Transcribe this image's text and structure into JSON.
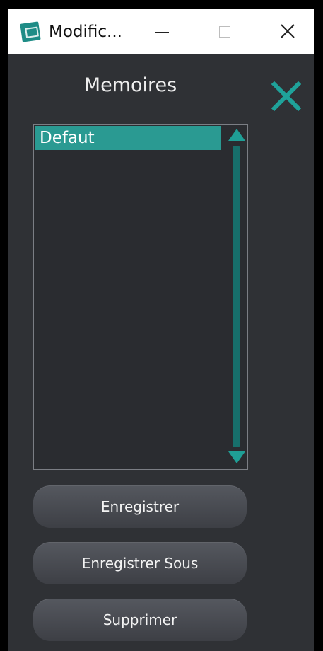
{
  "window": {
    "title": "Modific...",
    "controls": {
      "minimize": "minimize",
      "maximize": "maximize",
      "close": "close"
    }
  },
  "panel": {
    "title": "Memoires",
    "close_icon": "x-icon"
  },
  "memories": {
    "items": [
      {
        "label": "Defaut",
        "selected": true
      }
    ]
  },
  "actions": {
    "save_label": "Enregistrer",
    "save_as_label": "Enregistrer Sous",
    "delete_label": "Supprimer"
  },
  "colors": {
    "accent": "#2a9a92",
    "panel_background": "#2f3135",
    "button_background": "#4a4d53"
  }
}
